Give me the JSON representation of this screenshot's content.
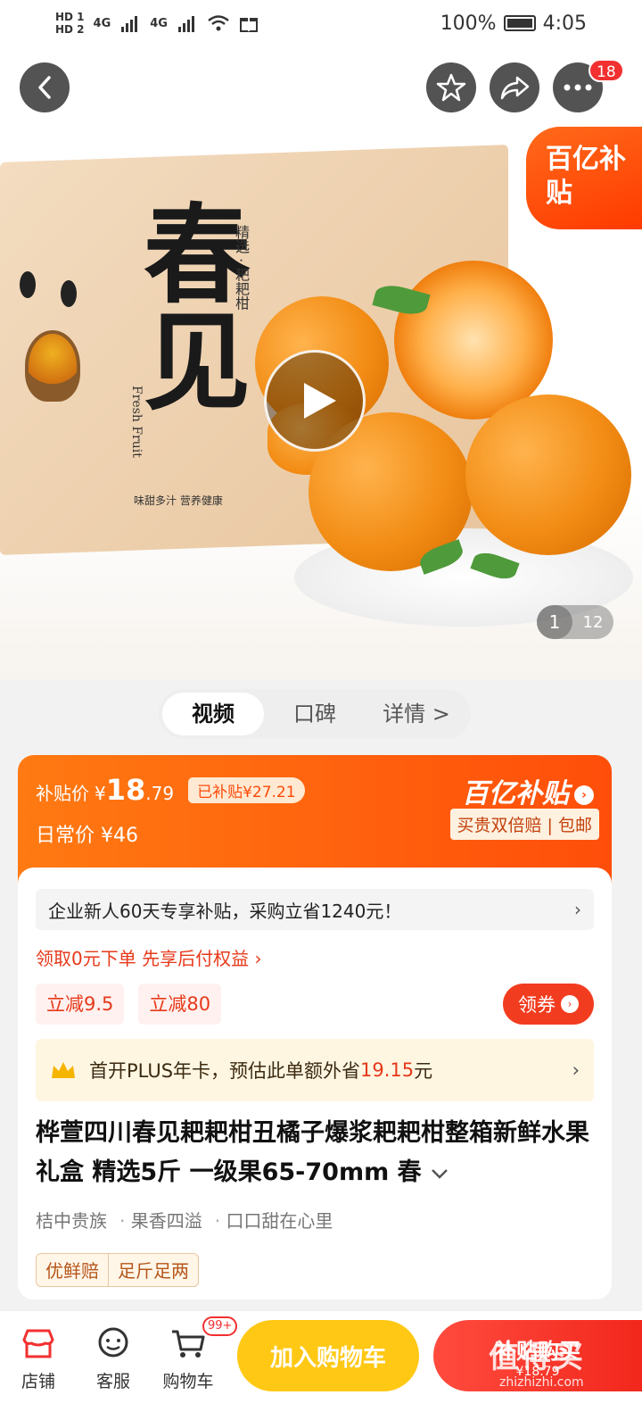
{
  "status_bar": {
    "hd1": "HD 1",
    "hd2": "HD 2",
    "net1": "4G",
    "net2": "4G",
    "battery": "100%",
    "time": "4:05"
  },
  "top_actions": {
    "notification_count": "18"
  },
  "hero": {
    "box_title": "春见",
    "box_subtitle": "精选 · 耙耙柑",
    "box_english": "Fresh Fruit",
    "box_slogan": "味甜多汁 营养健康",
    "subsidy_badge": "百亿补贴",
    "page_current": "1",
    "page_total": "12"
  },
  "tabs": [
    {
      "label": "视频"
    },
    {
      "label": "口碑"
    },
    {
      "label": "详情 >"
    }
  ],
  "price": {
    "label": "补贴价",
    "yen": "¥",
    "integer": "18",
    "decimal": ".79",
    "subsidized_tag": "已补贴¥27.21",
    "regular_label": "日常价 ¥46",
    "brand": "百亿补贴",
    "guarantee": "买贵双倍赔 | 包邮"
  },
  "promo": {
    "enterprise": "企业新人60天专享补贴，采购立省1240元！",
    "credit": "领取0元下单 先享后付权益 ›",
    "chips": [
      "立减9.5",
      "立减80"
    ],
    "coupon_button": "领券",
    "plus_text_prefix": "首开PLUS年卡，预估此单额外省",
    "plus_amount": "19.15",
    "plus_suffix": "元"
  },
  "product": {
    "title": "桦萱四川春见耙耙柑丑橘子爆浆耙耙柑整箱新鲜水果礼盒 精选5斤 一级果65-70mm 春",
    "tags": [
      "桔中贵族",
      "果香四溢",
      "口口甜在心里"
    ],
    "services": [
      "优鲜赔",
      "足斤足两"
    ]
  },
  "bottom_bar": {
    "shop": "店铺",
    "service": "客服",
    "cart": "购物车",
    "cart_badge": "99+",
    "add_to_cart": "加入购物车",
    "buy_line1": "补贴购买",
    "buy_line2": "¥18.79"
  },
  "watermark": {
    "main": "值得买",
    "sub": "zhizhizhi.com"
  },
  "colors": {
    "accent": "#ff4e0a",
    "buy": "#f2271c",
    "cart": "#ffc814"
  }
}
